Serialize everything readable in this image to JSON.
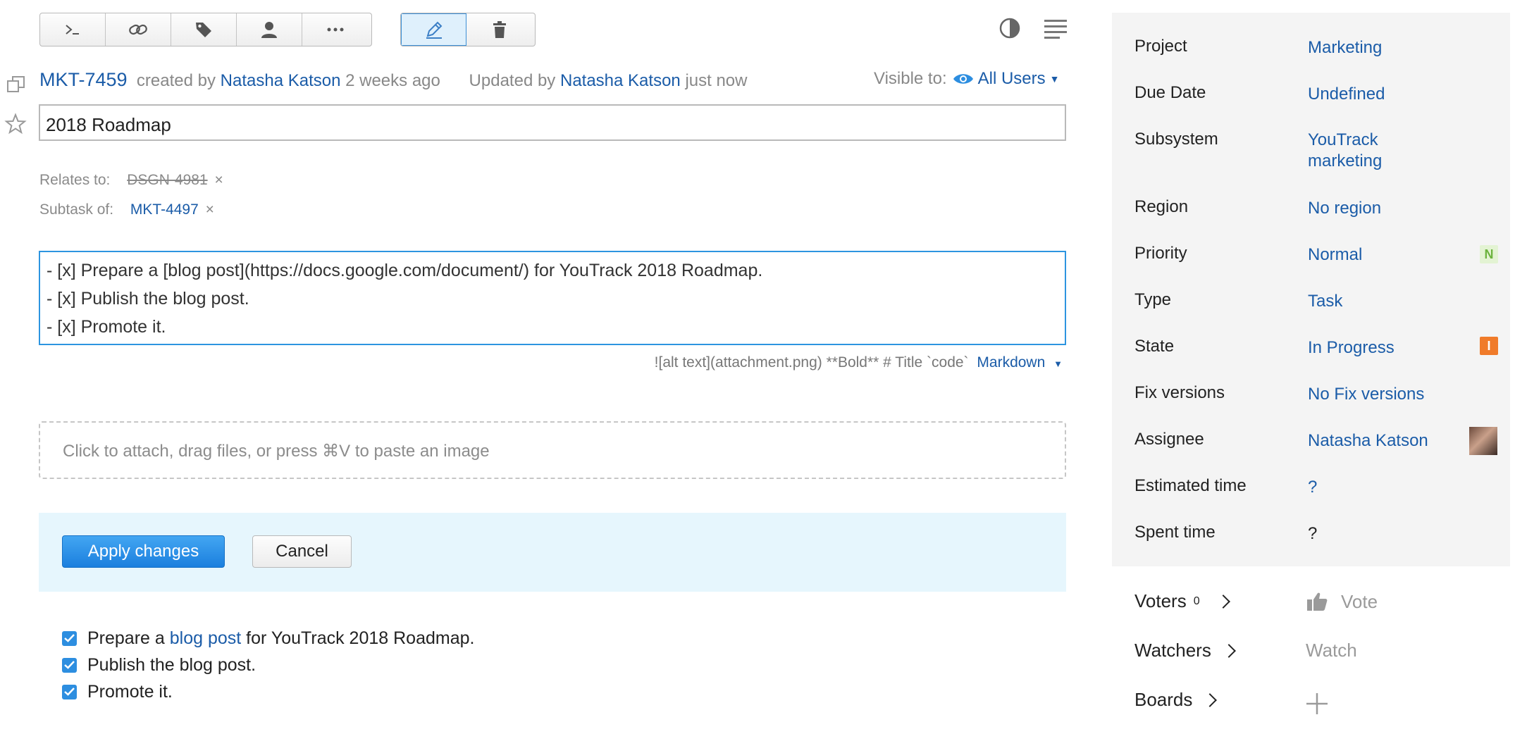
{
  "issue": {
    "id": "MKT-7459",
    "created_prefix": "created by",
    "creator": "Natasha Katson",
    "created_time": "2 weeks ago",
    "updated_prefix": "Updated by",
    "updater": "Natasha Katson",
    "updated_time": "just now",
    "visible_label": "Visible to:",
    "visible_value": "All Users",
    "summary": "2018 Roadmap"
  },
  "links": {
    "relates_label": "Relates to:",
    "relates_value": "DSGN-4981",
    "subtask_label": "Subtask of:",
    "subtask_value": "MKT-4497",
    "remove_glyph": "×"
  },
  "description": {
    "lines": [
      "- [x] Prepare a [blog post](https://docs.google.com/document/) for YouTrack 2018 Roadmap.",
      "- [x] Publish the blog post.",
      "- [x] Promote it."
    ],
    "hint": "![alt text](attachment.png) **Bold** # Title `code`",
    "mode": "Markdown"
  },
  "attach_text": "Click to attach, drag files, or press ⌘V to paste an image",
  "actions": {
    "apply": "Apply changes",
    "cancel": "Cancel"
  },
  "checklist": {
    "item1_before": "Prepare a",
    "item1_link": "blog post",
    "item1_after": "for YouTrack 2018 Roadmap.",
    "item2": "Publish the blog post.",
    "item3": "Promote it."
  },
  "fields": [
    {
      "label": "Project",
      "value": "Marketing"
    },
    {
      "label": "Due Date",
      "value": "Undefined"
    },
    {
      "label": "Subsystem",
      "value_line1": "YouTrack",
      "value_line2": "marketing"
    },
    {
      "label": "Region",
      "value": "No region"
    },
    {
      "label": "Priority",
      "value": "Normal",
      "badge": "N",
      "badge_color": "#8bc34a",
      "badge_bg": "#e3f3d3"
    },
    {
      "label": "Type",
      "value": "Task"
    },
    {
      "label": "State",
      "value": "In Progress",
      "badge": "I",
      "badge_color": "#ffffff",
      "badge_bg": "#f07b2a"
    },
    {
      "label": "Fix versions",
      "value": "No Fix versions"
    },
    {
      "label": "Assignee",
      "value": "Natasha Katson"
    },
    {
      "label": "Estimated time",
      "value": "?"
    },
    {
      "label": "Spent time",
      "value": "?"
    }
  ],
  "social": {
    "voters_label": "Voters",
    "voters_count": "0",
    "vote_label": "Vote",
    "watchers_label": "Watchers",
    "watch_label": "Watch",
    "boards_label": "Boards"
  },
  "colors": {
    "link": "#1b5ca8",
    "accent": "#2d8ee0",
    "apply_panel": "#e6f6fd",
    "fields_panel": "#f4f4f4"
  }
}
